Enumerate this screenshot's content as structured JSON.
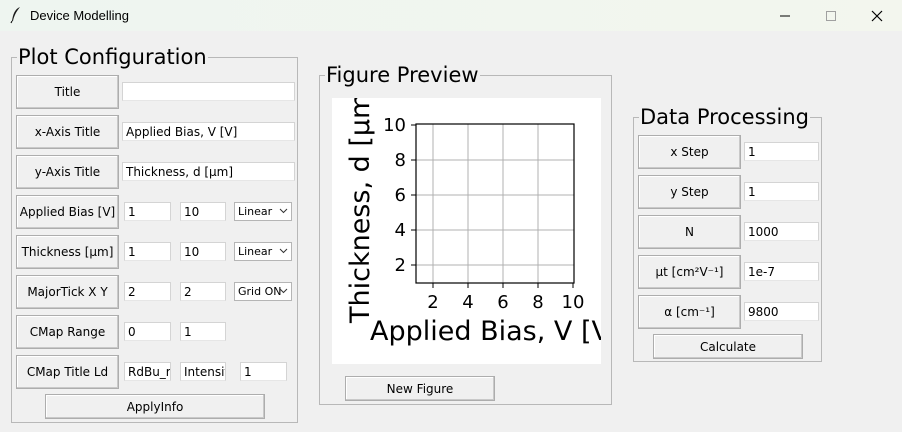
{
  "window": {
    "title": "Device Modelling",
    "icon": "feather-icon"
  },
  "plot_config": {
    "group_title": "Plot Configuration",
    "title_label": "Title",
    "title_value": "",
    "xaxis_label": "x-Axis Title",
    "xaxis_value": "Applied Bias, V [V]",
    "yaxis_label": "y-Axis Title",
    "yaxis_value": "Thickness, d [µm]",
    "bias": {
      "label": "Applied Bias [V]",
      "min": "1",
      "max": "10",
      "scale": "Linear"
    },
    "thickness": {
      "label": "Thickness [µm]",
      "min": "1",
      "max": "10",
      "scale": "Linear"
    },
    "majortick": {
      "label": "MajorTick X Y",
      "x": "2",
      "y": "2",
      "grid": "Grid ON"
    },
    "cmap_range": {
      "label": "CMap Range",
      "min": "0",
      "max": "1"
    },
    "cmap_title": {
      "label": "CMap Title Ld",
      "cmap": "RdBu_r",
      "title": "Intensit",
      "ld": "1"
    },
    "apply_label": "ApplyInfo"
  },
  "preview": {
    "group_title": "Figure Preview",
    "new_figure_label": "New Figure",
    "xlabel": "Applied Bias, V [V",
    "ylabel": "Thickness, d [µm",
    "x_ticks": [
      "2",
      "4",
      "6",
      "8",
      "10"
    ],
    "y_ticks": [
      "2",
      "4",
      "6",
      "8",
      "10"
    ]
  },
  "data_processing": {
    "group_title": "Data Processing",
    "rows": [
      {
        "label": "x Step",
        "value": "1"
      },
      {
        "label": "y Step",
        "value": "1"
      },
      {
        "label": "N",
        "value": "1000"
      },
      {
        "label": "µt [cm²V⁻¹]",
        "value": "1e-7"
      },
      {
        "label": "α [cm⁻¹]",
        "value": "9800"
      }
    ],
    "calculate_label": "Calculate"
  }
}
